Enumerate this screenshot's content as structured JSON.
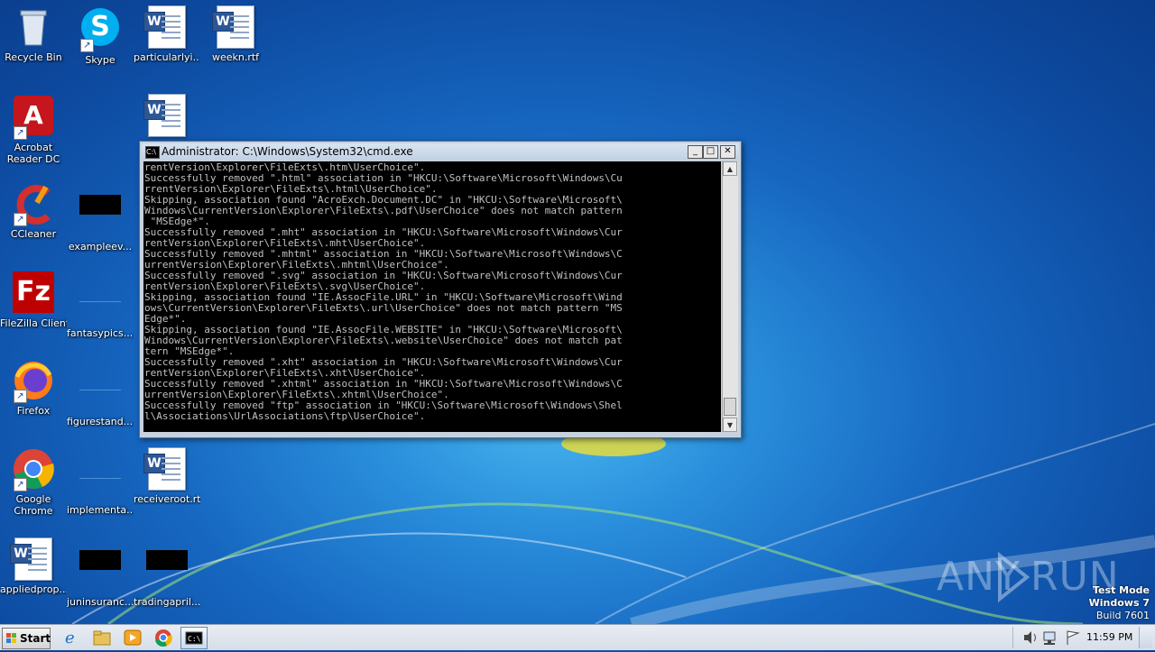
{
  "desktop_icons": [
    {
      "label": "Recycle Bin",
      "icon": "recycle-bin-icon"
    },
    {
      "label": "Skype",
      "icon": "skype-icon"
    },
    {
      "label": "particularlyi...",
      "icon": "word-document-icon"
    },
    {
      "label": "weekn.rtf",
      "icon": "word-document-icon"
    },
    {
      "label": "Acrobat Reader DC",
      "icon": "acrobat-icon"
    },
    {
      "label": "",
      "icon": "word-document-icon"
    },
    {
      "label": "CCleaner",
      "icon": "ccleaner-icon"
    },
    {
      "label": "exampleev...",
      "icon": "file-icon"
    },
    {
      "label": "FileZilla Client",
      "icon": "filezilla-icon"
    },
    {
      "label": "fantasypics....",
      "icon": "file-icon"
    },
    {
      "label": "Firefox",
      "icon": "firefox-icon"
    },
    {
      "label": "figurestand....",
      "icon": "file-icon"
    },
    {
      "label": "Google Chrome",
      "icon": "chrome-icon"
    },
    {
      "label": "implementa...",
      "icon": "file-icon"
    },
    {
      "label": "receiveroot.rtf",
      "icon": "word-document-icon"
    },
    {
      "label": "appliedprop...",
      "icon": "word-document-icon"
    },
    {
      "label": "juninsuranc...",
      "icon": "file-icon"
    },
    {
      "label": "tradingapril...",
      "icon": "file-icon"
    }
  ],
  "cmd": {
    "title": "Administrator: C:\\Windows\\System32\\cmd.exe",
    "lines": [
      "rentVersion\\Explorer\\FileExts\\.htm\\UserChoice\".",
      "Successfully removed \".html\" association in \"HKCU:\\Software\\Microsoft\\Windows\\Cu",
      "rrentVersion\\Explorer\\FileExts\\.html\\UserChoice\".",
      "Skipping, association found \"AcroExch.Document.DC\" in \"HKCU:\\Software\\Microsoft\\",
      "Windows\\CurrentVersion\\Explorer\\FileExts\\.pdf\\UserChoice\" does not match pattern",
      " \"MSEdge*\".",
      "Successfully removed \".mht\" association in \"HKCU:\\Software\\Microsoft\\Windows\\Cur",
      "rentVersion\\Explorer\\FileExts\\.mht\\UserChoice\".",
      "Successfully removed \".mhtml\" association in \"HKCU:\\Software\\Microsoft\\Windows\\C",
      "urrentVersion\\Explorer\\FileExts\\.mhtml\\UserChoice\".",
      "Successfully removed \".svg\" association in \"HKCU:\\Software\\Microsoft\\Windows\\Cur",
      "rentVersion\\Explorer\\FileExts\\.svg\\UserChoice\".",
      "Skipping, association found \"IE.AssocFile.URL\" in \"HKCU:\\Software\\Microsoft\\Wind",
      "ows\\CurrentVersion\\Explorer\\FileExts\\.url\\UserChoice\" does not match pattern \"MS",
      "Edge*\".",
      "Skipping, association found \"IE.AssocFile.WEBSITE\" in \"HKCU:\\Software\\Microsoft\\",
      "Windows\\CurrentVersion\\Explorer\\FileExts\\.website\\UserChoice\" does not match pat",
      "tern \"MSEdge*\".",
      "Successfully removed \".xht\" association in \"HKCU:\\Software\\Microsoft\\Windows\\Cur",
      "rentVersion\\Explorer\\FileExts\\.xht\\UserChoice\".",
      "Successfully removed \".xhtml\" association in \"HKCU:\\Software\\Microsoft\\Windows\\C",
      "urrentVersion\\Explorer\\FileExts\\.xhtml\\UserChoice\".",
      "Successfully removed \"ftp\" association in \"HKCU:\\Software\\Microsoft\\Windows\\Shel",
      "l\\Associations\\UrlAssociations\\ftp\\UserChoice\"."
    ]
  },
  "watermark": {
    "any": "ANY",
    "run": "RUN"
  },
  "test_mode": {
    "line1": "Test Mode",
    "line2": "Windows 7",
    "line3": "Build 7601"
  },
  "taskbar": {
    "start_label": "Start",
    "pinned": [
      "internet-explorer-icon",
      "explorer-folder-icon",
      "media-player-icon",
      "chrome-icon",
      "cmd-icon"
    ],
    "clock": "11:59 PM"
  }
}
